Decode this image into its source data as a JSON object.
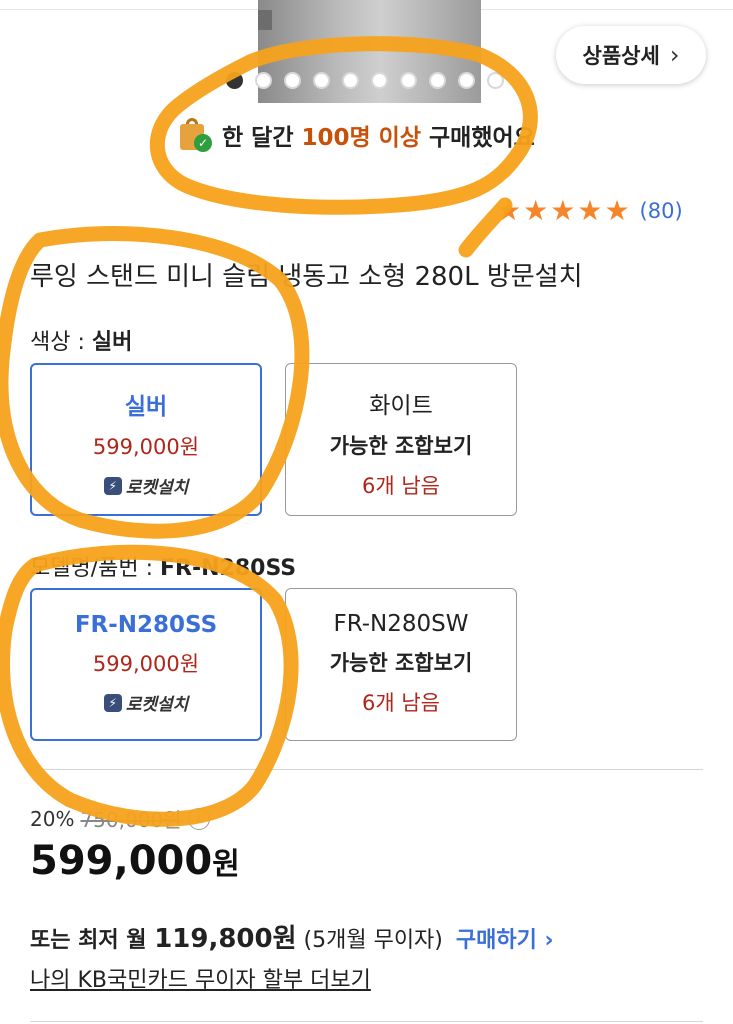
{
  "header": {
    "detail_button_label": "상품상세",
    "detail_chevron": "›"
  },
  "gallery": {
    "dot_count": 10,
    "active_index": 0
  },
  "social_proof": {
    "prefix": "한 달간 ",
    "highlight": "100명 이상",
    "suffix": " 구매했어요"
  },
  "rating": {
    "stars": 5,
    "star_glyph": "★",
    "review_count": "(80)"
  },
  "product_title": "루잉 스탠드 미니 슬림 냉동고 소형 280L 방문설치",
  "color_option": {
    "label": "색상 : ",
    "selected_value": "실버",
    "choices": [
      {
        "name": "실버",
        "price": "599,000원",
        "badge": "로켓설치"
      },
      {
        "name": "화이트",
        "sub": "가능한 조합보기",
        "stock": "6개 남음"
      }
    ]
  },
  "model_option": {
    "label": "모델명/품번 : ",
    "selected_value": "FR-N280SS",
    "choices": [
      {
        "name": "FR-N280SS",
        "price": "599,000원",
        "badge": "로켓설치"
      },
      {
        "name": "FR-N280SW",
        "sub": "가능한 조합보기",
        "stock": "6개 남음"
      }
    ]
  },
  "pricing": {
    "discount_rate": "20%",
    "original_price": "750,000원",
    "info_glyph": "i",
    "final_price": "599,000",
    "final_unit": "원"
  },
  "installment": {
    "lead": "또는 최저 ",
    "month_label": "월 ",
    "amount": "119,800원",
    "terms": " (5개월 무이자) ",
    "buy_label": "구매하기",
    "buy_chevron": "›"
  },
  "card_promo": "나의 KB국민카드 무이자 할부 더보기",
  "colors": {
    "accent_blue": "#3a6fd8",
    "price_red": "#b0261b",
    "highlight_orange": "#c8510a",
    "annotation_orange": "#f7a21b",
    "star_orange": "#f5852b"
  }
}
